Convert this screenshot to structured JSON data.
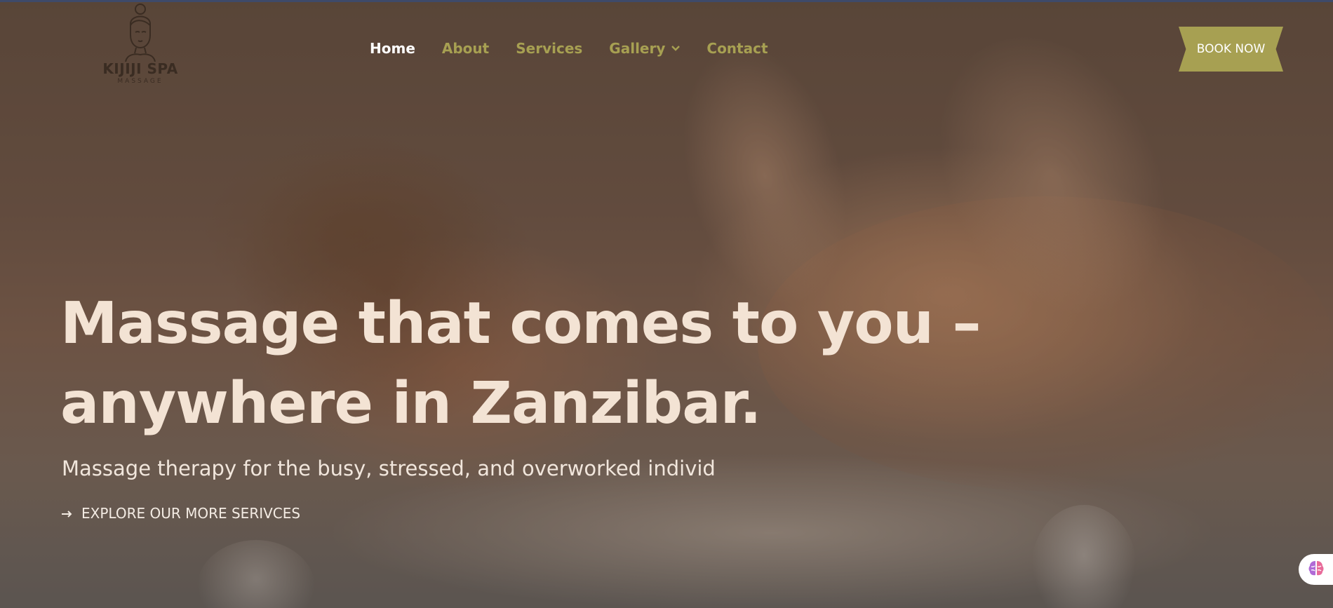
{
  "colors": {
    "accent": "#a7a052",
    "nav_active": "#ffffff",
    "headline": "#f3e3d4"
  },
  "logo": {
    "title": "KIJIJI SPA",
    "subtitle": "MASSAGE",
    "icon": "woman-face-icon"
  },
  "nav": {
    "items": [
      {
        "label": "Home",
        "active": true
      },
      {
        "label": "About",
        "active": false
      },
      {
        "label": "Services",
        "active": false
      },
      {
        "label": "Gallery",
        "active": false,
        "dropdown": true
      },
      {
        "label": "Contact",
        "active": false
      }
    ],
    "dropdown_icon": "chevron-down-icon"
  },
  "book_button": {
    "label": "BOOK NOW"
  },
  "hero": {
    "headline_line1": "Massage that comes to you –",
    "headline_line2": "anywhere in Zanzibar.",
    "subline": "Massage therapy for the busy, stressed, and overworked individ",
    "explore_label": "EXPLORE OUR MORE SERIVCES",
    "explore_icon": "arrow-right-icon"
  },
  "floating_widget": {
    "icon": "brain-icon"
  }
}
